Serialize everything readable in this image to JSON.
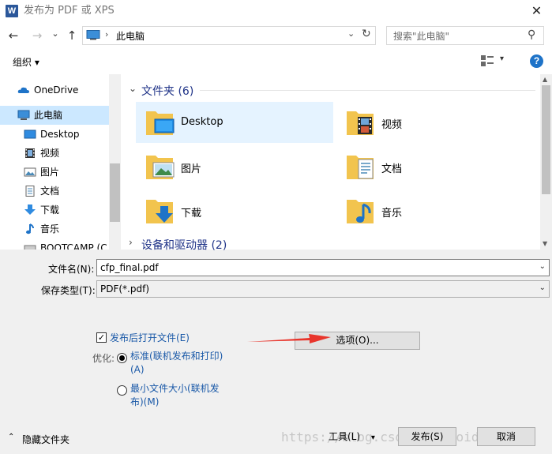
{
  "window": {
    "title": "发布为 PDF 或 XPS",
    "app_icon_letter": "W",
    "close_glyph": "✕"
  },
  "nav": {
    "back_glyph": "←",
    "forward_glyph": "→",
    "recent_glyph": "⌄",
    "up_glyph": "↑",
    "address": "此电脑",
    "address_sep": "›",
    "address_drop": "⌄",
    "refresh_glyph": "↻",
    "search_placeholder": "搜索\"此电脑\"",
    "search_glyph": "⚲"
  },
  "toolbar": {
    "organize": "组织 ▾",
    "view_drop": "▾",
    "help": "?"
  },
  "sidebar": {
    "items": [
      {
        "label": "OneDrive",
        "icon": "cloud-icon"
      },
      {
        "label": "此电脑",
        "icon": "computer-icon"
      },
      {
        "label": "Desktop",
        "icon": "desktop-icon"
      },
      {
        "label": "视频",
        "icon": "video-icon"
      },
      {
        "label": "图片",
        "icon": "picture-icon"
      },
      {
        "label": "文档",
        "icon": "document-icon"
      },
      {
        "label": "下载",
        "icon": "download-icon"
      },
      {
        "label": "音乐",
        "icon": "music-icon"
      },
      {
        "label": "BOOTCAMP (C",
        "icon": "drive-icon"
      }
    ]
  },
  "content": {
    "group1": "文件夹 (6)",
    "group1_chev": "⌄",
    "group2": "设备和驱动器 (2)",
    "group2_chev": "›",
    "folders": [
      {
        "label": "Desktop",
        "icon": "desktop-folder-icon"
      },
      {
        "label": "视频",
        "icon": "video-folder-icon"
      },
      {
        "label": "图片",
        "icon": "picture-folder-icon"
      },
      {
        "label": "文档",
        "icon": "document-folder-icon"
      },
      {
        "label": "下载",
        "icon": "download-folder-icon"
      },
      {
        "label": "音乐",
        "icon": "music-folder-icon"
      }
    ]
  },
  "form": {
    "filename_label": "文件名(N):",
    "filename_value": "cfp_final.pdf",
    "type_label": "保存类型(T):",
    "type_value": "PDF(*.pdf)",
    "drop_glyph": "⌄"
  },
  "options": {
    "open_after_publish": "发布后打开文件(E)",
    "checked_glyph": "✓",
    "optimize_label": "优化:",
    "standard_line1": "标准(联机发布和打印)",
    "standard_line2": "(A)",
    "minimum_line1": "最小文件大小(联机发",
    "minimum_line2": "布)(M)",
    "options_button": "选项(O)..."
  },
  "footer": {
    "hide_folders": "隐藏文件夹",
    "hide_chev": "⌃",
    "tools": "工具(L)",
    "tools_drop": "▾",
    "publish": "发布(S)",
    "cancel": "取消",
    "watermark": "https://blog.csdn.net/Void_worker"
  },
  "colors": {
    "accent": "#1e73c8",
    "selection": "#cce8ff",
    "link_blue": "#1a59a8",
    "arrow_red": "#e8352c",
    "folder_yellow": "#f2c44e"
  }
}
